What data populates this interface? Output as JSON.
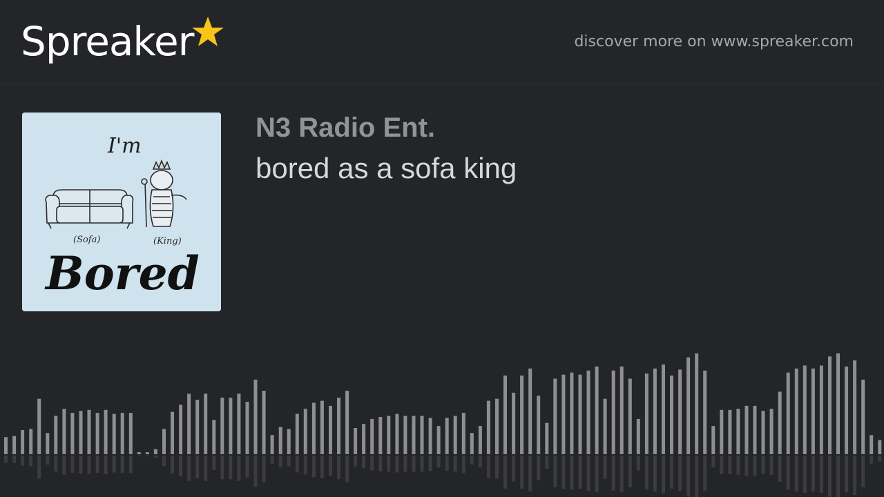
{
  "brand": {
    "name": "Spreaker",
    "star_color": "#f5c518"
  },
  "header": {
    "discover_text": "discover more on www.spreaker.com"
  },
  "show": {
    "title": "N3 Radio Ent."
  },
  "episode": {
    "title": "bored as a sofa king"
  },
  "cover_art": {
    "background": "#cfe3ee",
    "top_text": "I'm",
    "sofa_label": "(Sofa)",
    "king_label": "(King)",
    "bottom_text": "Bored"
  },
  "waveform": {
    "bar_color": "#8e8f92",
    "levels": [
      0.17,
      0.18,
      0.24,
      0.25,
      0.55,
      0.21,
      0.38,
      0.45,
      0.41,
      0.43,
      0.44,
      0.41,
      0.44,
      0.4,
      0.41,
      0.41,
      0.02,
      0.02,
      0.05,
      0.25,
      0.42,
      0.49,
      0.6,
      0.54,
      0.6,
      0.34,
      0.56,
      0.56,
      0.6,
      0.52,
      0.74,
      0.63,
      0.19,
      0.27,
      0.25,
      0.4,
      0.45,
      0.51,
      0.53,
      0.48,
      0.56,
      0.63,
      0.26,
      0.3,
      0.35,
      0.37,
      0.38,
      0.4,
      0.38,
      0.38,
      0.38,
      0.36,
      0.28,
      0.36,
      0.38,
      0.41,
      0.21,
      0.28,
      0.53,
      0.55,
      0.78,
      0.61,
      0.78,
      0.85,
      0.58,
      0.31,
      0.75,
      0.79,
      0.81,
      0.79,
      0.83,
      0.87,
      0.55,
      0.83,
      0.87,
      0.75,
      0.35,
      0.8,
      0.85,
      0.89,
      0.78,
      0.84,
      0.96,
      1.0,
      0.83,
      0.28,
      0.44,
      0.44,
      0.45,
      0.48,
      0.48,
      0.43,
      0.45,
      0.62,
      0.81,
      0.85,
      0.88,
      0.85,
      0.88,
      0.97,
      1.0,
      0.87,
      0.93,
      0.74,
      0.19,
      0.14
    ]
  }
}
